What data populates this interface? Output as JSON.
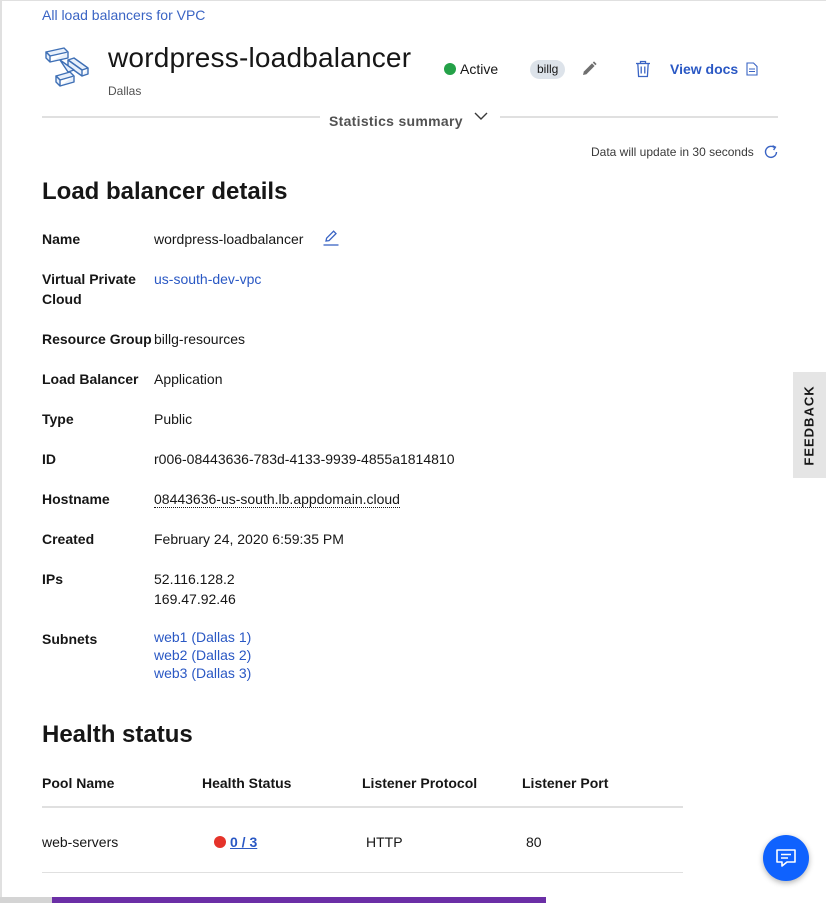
{
  "breadcrumb": {
    "back_label": "All load balancers for VPC"
  },
  "header": {
    "title": "wordpress-loadbalancer",
    "location": "Dallas",
    "status": "Active",
    "status_color": "#24a148",
    "tag": "billg",
    "docs_label": "View docs",
    "icons": [
      "load-balancer-icon",
      "pencil-icon",
      "trash-icon",
      "document-icon"
    ]
  },
  "stats": {
    "summary_label": "Statistics summary",
    "update_text": "Data will update in 30 seconds"
  },
  "details": {
    "heading": "Load balancer details",
    "rows": [
      {
        "label": "Name",
        "value": "wordpress-loadbalancer"
      },
      {
        "label": "Virtual Private Cloud",
        "value": "us-south-dev-vpc"
      },
      {
        "label": "Resource Group",
        "value": "billg-resources"
      },
      {
        "label": "Load Balancer",
        "value": "Application"
      },
      {
        "label": "Type",
        "value": "Public"
      },
      {
        "label": "ID",
        "value": "r006-08443636-783d-4133-9939-4855a1814810"
      },
      {
        "label": "Hostname",
        "value": "08443636-us-south.lb.appdomain.cloud"
      },
      {
        "label": "Created",
        "value": "February 24, 2020 6:59:35 PM"
      },
      {
        "label": "IPs",
        "values": [
          "52.116.128.2",
          "169.47.92.46"
        ]
      },
      {
        "label": "Subnets",
        "values": [
          "web1 (Dallas 1)",
          "web2 (Dallas 2)",
          "web3 (Dallas 3)"
        ]
      }
    ]
  },
  "feedback": {
    "label": "FEEDBACK"
  },
  "health": {
    "heading": "Health status",
    "columns": [
      "Pool Name",
      "Health Status",
      "Listener Protocol",
      "Listener Port"
    ],
    "rows": [
      {
        "pool": "web-servers",
        "health": "0 / 3",
        "health_color": "#e5332a",
        "protocol": "HTTP",
        "port": "80"
      }
    ]
  }
}
